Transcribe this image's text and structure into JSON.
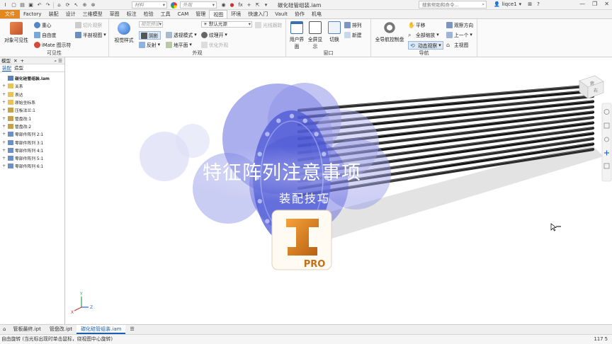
{
  "window": {
    "doc_title": "碳化硅管组装.iam",
    "search_placeholder": "搜索帮助和命令...",
    "user": "liqce1",
    "material_combo": "材料",
    "appearance_combo": "外观"
  },
  "menu_tabs": [
    "文件",
    "Factory",
    "装配",
    "设计",
    "三维模型",
    "草图",
    "标注",
    "检验",
    "工具",
    "CAM",
    "管理",
    "视图",
    "环境",
    "快速入门",
    "Vault",
    "协作",
    "机电"
  ],
  "ribbon": {
    "visibility": {
      "label": "可见性",
      "object_visibility": "对象可见性",
      "center_of_gravity": "重心",
      "dof": "自由度",
      "imate_glyph": "iMate 图示符",
      "slice_view": "切片观察",
      "half_section": "半剖视图"
    },
    "appearance": {
      "label": "外观",
      "visual_style": "视觉样式",
      "visual_preset_combo": "视觉预设",
      "shadow": "阴影",
      "reflection": "反射",
      "perspective": "透视模式",
      "ground_plane": "地平面",
      "texture_on": "纹理开",
      "optimize_appearance": "优化外观",
      "lighting_combo": "默认光源",
      "ray_tracing": "光线跟踪"
    },
    "windows": {
      "label": "窗口",
      "user_interface": "用户界面",
      "full_screen": "全屏显示",
      "switch": "切换",
      "arrange": "排列",
      "new": "新建"
    },
    "navigate": {
      "label": "导航",
      "full_nav_wheel": "全导航控制盘",
      "pan": "平移",
      "zoom_all": "全部缩放",
      "orbit": "动态观察",
      "look_at": "观察方向",
      "previous": "上一个",
      "home_view": "主视图"
    }
  },
  "browser": {
    "title": "模型",
    "tabs": [
      "装配",
      "造型"
    ],
    "tree": [
      {
        "label": "碳化硅管组装.iam",
        "expand": "",
        "icon": "assembly-icon",
        "bold": true
      },
      {
        "label": "关系",
        "expand": "+",
        "icon": "folder-icon"
      },
      {
        "label": "表达",
        "expand": "+",
        "icon": "folder-icon"
      },
      {
        "label": "原始坐标系",
        "expand": "+",
        "icon": "folder-icon"
      },
      {
        "label": "压板法兰:1",
        "expand": "+",
        "icon": "part-icon"
      },
      {
        "label": "管盘改:1",
        "expand": "+",
        "icon": "part-icon"
      },
      {
        "label": "管盘改:2",
        "expand": "+",
        "icon": "part-icon"
      },
      {
        "label": "零部件阵列 2:1",
        "expand": "+",
        "icon": "pattern-icon"
      },
      {
        "label": "零部件阵列 3:1",
        "expand": "+",
        "icon": "pattern-icon"
      },
      {
        "label": "零部件阵列 4:1",
        "expand": "+",
        "icon": "pattern-icon"
      },
      {
        "label": "零部件阵列 5:1",
        "expand": "+",
        "icon": "pattern-icon"
      },
      {
        "label": "零部件阵列 6:1",
        "expand": "+",
        "icon": "pattern-icon"
      }
    ]
  },
  "viewport": {
    "overlay_title": "特征阵列注意事项",
    "overlay_subtitle": "装配技巧",
    "logo_letter": "I",
    "logo_badge": "PRO",
    "viewcube_faces": [
      "俯",
      "右"
    ],
    "axis_x": "X",
    "axis_y": "Y",
    "axis_z": "Z"
  },
  "doc_tabs": [
    "管板最终.ipt",
    "管盘改.ipt",
    "碳化硅管组装.iam"
  ],
  "status": {
    "text": "自由旋转 (当光标出现时单击鼠标，绕视图中心旋转)",
    "numbers": "117   5"
  },
  "colors": {
    "file_tab": "#e3871f",
    "accent_blue": "#1a5fb4",
    "overlay_blue": "#3b43d6",
    "logo_orange": "#e08a1e"
  }
}
